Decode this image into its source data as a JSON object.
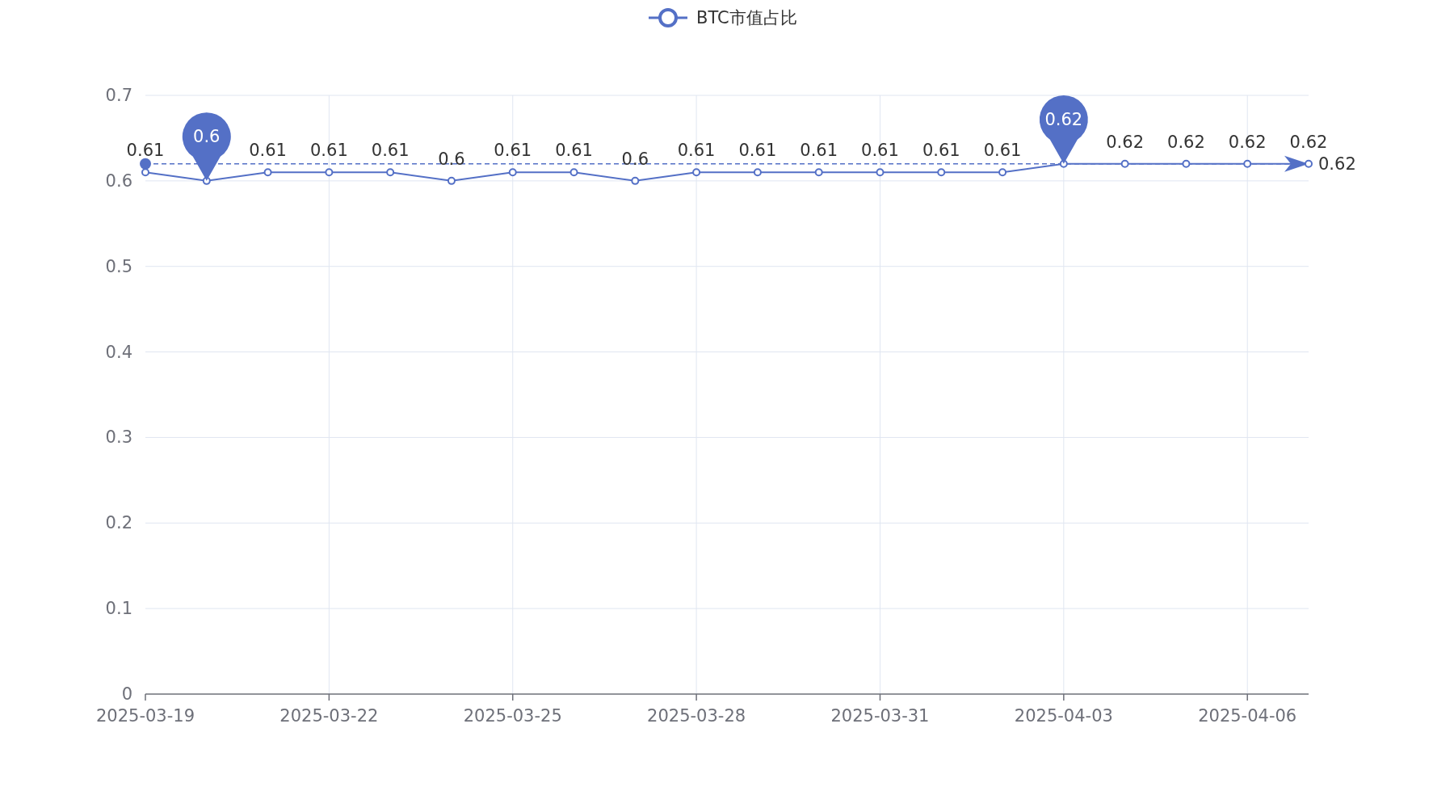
{
  "chart_data": {
    "type": "line",
    "categories": [
      "2025-03-19",
      null,
      null,
      "2025-03-22",
      null,
      null,
      "2025-03-25",
      null,
      null,
      "2025-03-28",
      null,
      null,
      "2025-03-31",
      null,
      null,
      "2025-04-03",
      null,
      null,
      "2025-04-06",
      null
    ],
    "series": [
      {
        "name": "BTC市值占比",
        "color": "#5470c6",
        "marker": "circle",
        "values": [
          0.61,
          0.6,
          0.61,
          0.61,
          0.61,
          0.6,
          0.61,
          0.61,
          0.6,
          0.61,
          0.61,
          0.61,
          0.61,
          0.61,
          0.61,
          0.62,
          0.62,
          0.62,
          0.62,
          0.62
        ]
      }
    ],
    "ylim": [
      0,
      0.7
    ],
    "yticks": [
      {
        "value": 0,
        "label": "0"
      },
      {
        "value": 0.1,
        "label": "0.1"
      },
      {
        "value": 0.2,
        "label": "0.2"
      },
      {
        "value": 0.3,
        "label": "0.3"
      },
      {
        "value": 0.4,
        "label": "0.4"
      },
      {
        "value": 0.5,
        "label": "0.5"
      },
      {
        "value": 0.6,
        "label": "0.6"
      },
      {
        "value": 0.7,
        "label": "0.7"
      }
    ],
    "grid": true,
    "value_labels": [
      "0.61",
      null,
      "0.61",
      "0.61",
      "0.61",
      "0.6",
      "0.61",
      "0.61",
      "0.6",
      "0.61",
      "0.61",
      "0.61",
      "0.61",
      "0.61",
      "0.61",
      null,
      "0.62",
      "0.62",
      "0.62",
      "0.62"
    ],
    "annotations": [
      {
        "text": "0.6",
        "y": 0.6
      },
      {
        "text": "0.62",
        "y": 0.62
      }
    ],
    "ref_lines": [
      {
        "axis": "y",
        "value": 0.62,
        "label": "0.62"
      }
    ]
  }
}
